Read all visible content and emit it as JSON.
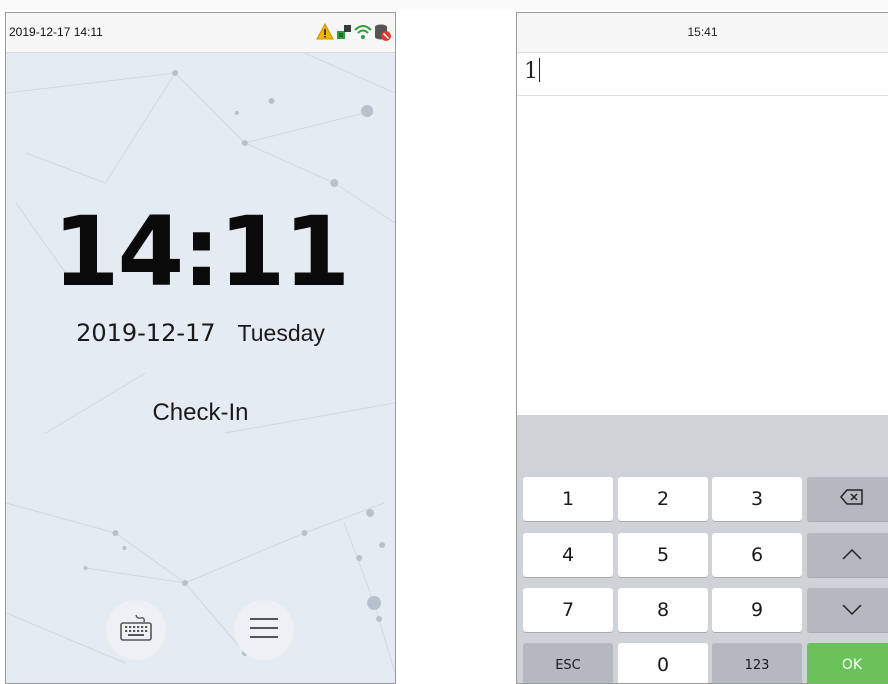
{
  "left_screen": {
    "status_bar": {
      "datetime": "2019-12-17 14:11",
      "icons": [
        "warning-icon",
        "network-icon",
        "wifi-icon",
        "database-alert-icon"
      ]
    },
    "clock": "14:11",
    "date": "2019-12-17",
    "weekday": "Tuesday",
    "mode": "Check-In",
    "buttons": [
      "keyboard-icon",
      "menu-icon"
    ]
  },
  "right_screen": {
    "status_time": "15:41",
    "input_value": "1",
    "keypad": {
      "row1": [
        "1",
        "2",
        "3",
        "backspace-icon"
      ],
      "row2": [
        "4",
        "5",
        "6",
        "chevron-up-icon"
      ],
      "row3": [
        "7",
        "8",
        "9",
        "chevron-down-icon"
      ],
      "row4": [
        "ESC",
        "0",
        "123",
        "OK"
      ]
    },
    "labels": {
      "k1": "1",
      "k2": "2",
      "k3": "3",
      "k4": "4",
      "k5": "5",
      "k6": "6",
      "k7": "7",
      "k8": "8",
      "k9": "9",
      "esc": "ESC",
      "k0": "0",
      "mode123": "123",
      "ok": "OK"
    },
    "colors": {
      "ok_key": "#6ac259",
      "function_key": "#b4b9c0",
      "keypad_bg": "#cfd3d8"
    }
  }
}
